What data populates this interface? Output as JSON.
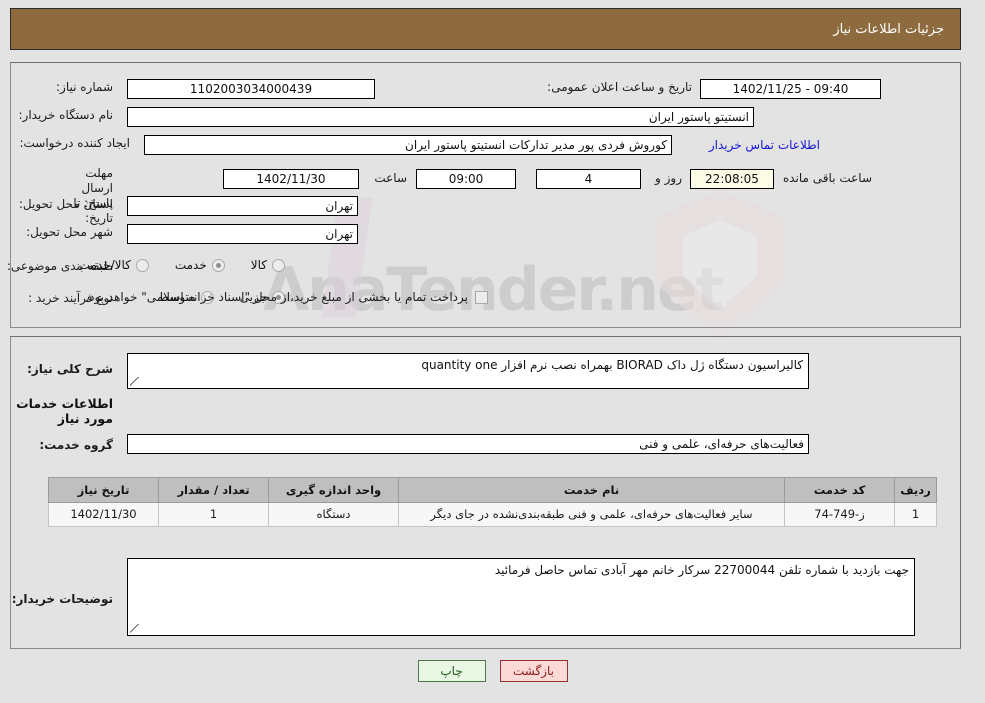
{
  "header": {
    "title": "جزئیات اطلاعات نیاز"
  },
  "colors": {
    "header_bar": "#8d6b3f",
    "page_bg": "#e3e3e3",
    "link": "#1414d6",
    "table_header": "#bfbfbf",
    "countdown_bg": "#fbfbe6",
    "print_button": "#e9f7e5",
    "back_button": "#fbd9d6"
  },
  "top_form": {
    "need_number_label": "شماره نیاز:",
    "need_number_value": "1102003034000439",
    "public_announce_label": "تاریخ و ساعت اعلان عمومی:",
    "public_announce_value": "09:40 - 1402/11/25",
    "buyer_org_label": "نام دستگاه خریدار:",
    "buyer_org_value": "انستیتو پاستور ایران",
    "requester_label": "ایجاد کننده درخواست:",
    "requester_value": "کوروش فردی پور مدیر تدارکات انستیتو پاستور ایران",
    "buyer_contact_link": "اطلاعات تماس خریدار",
    "deadline_label": "مهلت ارسال پاسخ: تا تاریخ:",
    "deadline_date": "1402/11/30",
    "deadline_hour_label": "ساعت",
    "deadline_hour": "09:00",
    "remaining_days": "4",
    "remaining_days_label": "روز و",
    "remaining_time": "22:08:05",
    "remaining_time_label": "ساعت باقی مانده",
    "province_label": "استان محل تحویل:",
    "province_value": "تهران",
    "city_label": "شهر محل تحویل:",
    "city_value": "تهران",
    "category_label": "طبقه بندی موضوعی:",
    "category_options": [
      {
        "label": "کالا",
        "selected": false
      },
      {
        "label": "خدمت",
        "selected": true
      },
      {
        "label": "کالا/خدمت",
        "selected": false
      }
    ],
    "process_label": "نوع فرآیند خرید :",
    "process_options": [
      {
        "label": "جزیی",
        "selected": true
      },
      {
        "label": "متوسط",
        "selected": false
      }
    ],
    "treasury_checkbox_label": "پرداخت تمام یا بخشی از مبلغ خرید،از محل \"اسناد خزانه اسلامی\" خواهد بود.",
    "treasury_checked": false
  },
  "bottom_form": {
    "general_desc_label": "شرح کلی نیاز:",
    "general_desc_value": "کالیراسیون دستگاه ژل داک  BIORAD  بهمراه نصب نرم افزار quantity one",
    "services_heading": "اطلاعات خدمات مورد نیاز",
    "service_group_label": "گروه خدمت:",
    "service_group_value": "فعالیت‌های حرفه‌ای، علمی و فنی",
    "buyer_notes_label": "توضیحات خریدار:",
    "buyer_notes_value": "جهت بازدید با شماره تلفن 22700044 سرکار خانم مهر آبادی تماس حاصل فرمائید"
  },
  "table": {
    "headers": [
      "ردیف",
      "کد خدمت",
      "نام خدمت",
      "واحد اندازه گیری",
      "تعداد / مقدار",
      "تاریخ نیاز"
    ],
    "rows": [
      {
        "index": "1",
        "code": "ز-749-74",
        "name": "سایر فعالیت‌های حرفه‌ای، علمی و فنی طبقه‌بندی‌نشده در جای دیگر",
        "unit": "دستگاه",
        "quantity": "1",
        "need_date": "1402/11/30"
      }
    ]
  },
  "buttons": {
    "print": "چاپ",
    "back": "بازگشت"
  },
  "watermark": {
    "text": "AnaTender.net"
  }
}
